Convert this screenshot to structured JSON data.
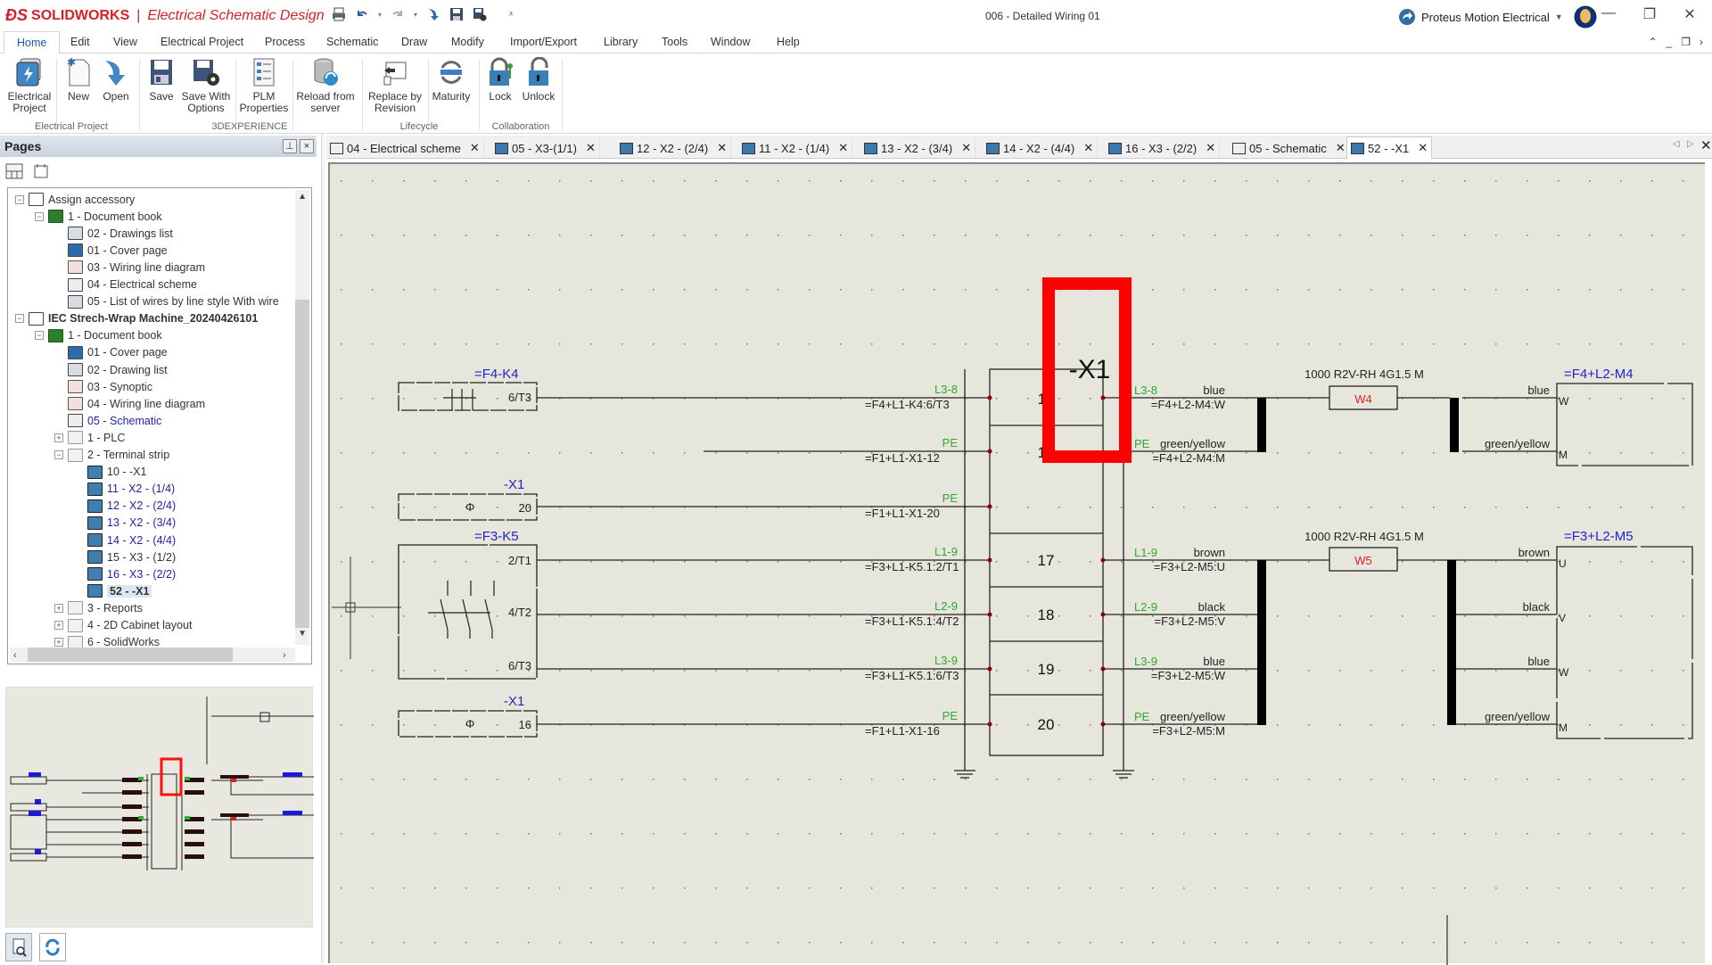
{
  "app": {
    "brand": "SOLIDWORKS",
    "product": "Electrical Schematic Design",
    "document_title": "006 - Detailed Wiring 01",
    "account": "Proteus Motion Electrical"
  },
  "window_controls": {
    "minimize": "—",
    "restore": "❐",
    "close": "✕"
  },
  "menu": {
    "items": [
      "Home",
      "Edit",
      "View",
      "Electrical Project",
      "Process",
      "Schematic",
      "Draw",
      "Modify",
      "Import/Export",
      "Library",
      "Tools",
      "Window",
      "Help"
    ],
    "active": "Home",
    "right_controls": [
      "⌃",
      "_",
      "❐",
      "›"
    ]
  },
  "ribbon": {
    "buttons": [
      {
        "label": "Electrical\nProject",
        "l1": "Electrical",
        "l2": "Project"
      },
      {
        "l1": "New",
        "l2": ""
      },
      {
        "l1": "Open",
        "l2": ""
      },
      {
        "l1": "Save",
        "l2": ""
      },
      {
        "l1": "Save With",
        "l2": "Options"
      },
      {
        "l1": "PLM",
        "l2": "Properties"
      },
      {
        "l1": "Reload from",
        "l2": "server"
      },
      {
        "l1": "Replace by",
        "l2": "Revision"
      },
      {
        "l1": "Maturity",
        "l2": ""
      },
      {
        "l1": "Lock",
        "l2": ""
      },
      {
        "l1": "Unlock",
        "l2": ""
      }
    ],
    "groups": [
      "Electrical Project",
      "3DEXPERIENCE",
      "Lifecycle",
      "Collaboration"
    ]
  },
  "pages_panel": {
    "title": "Pages",
    "pin": "⊥",
    "close": "×",
    "tree": [
      {
        "level": 0,
        "exp": "−",
        "icon": "proj",
        "label": "Assign accessory"
      },
      {
        "level": 1,
        "exp": "−",
        "icon": "book",
        "label": "1 - Document book"
      },
      {
        "level": 2,
        "icon": "list",
        "label": "02 - Drawings list"
      },
      {
        "level": 2,
        "icon": "cover",
        "label": "01 - Cover page"
      },
      {
        "level": 2,
        "icon": "wiring",
        "label": "03 - Wiring line diagram"
      },
      {
        "level": 2,
        "icon": "scheme",
        "label": "04 - Electrical scheme"
      },
      {
        "level": 2,
        "icon": "list",
        "label": "05 - List of wires by line style With wire"
      },
      {
        "level": 0,
        "exp": "−",
        "icon": "proj",
        "label": "IEC Strech-Wrap Machine_20240426101",
        "bold": true
      },
      {
        "level": 1,
        "exp": "−",
        "icon": "book",
        "label": "1 - Document book"
      },
      {
        "level": 2,
        "icon": "cover",
        "label": "01 - Cover page"
      },
      {
        "level": 2,
        "icon": "list",
        "label": "02 - Drawing list"
      },
      {
        "level": 2,
        "icon": "wiring",
        "label": "03 - Synoptic"
      },
      {
        "level": 2,
        "icon": "wiring",
        "label": "04 - Wiring line diagram"
      },
      {
        "level": 2,
        "icon": "scheme",
        "label": "05 - Schematic",
        "blue": true
      },
      {
        "level": 2,
        "exp": "+",
        "icon": "folder",
        "label": "1 - PLC"
      },
      {
        "level": 2,
        "exp": "−",
        "icon": "folder",
        "label": "2 - Terminal strip"
      },
      {
        "level": 3,
        "icon": "strip",
        "label": "10 - -X1"
      },
      {
        "level": 3,
        "icon": "strip",
        "label": "11 - X2 - (1/4)",
        "blue": true
      },
      {
        "level": 3,
        "icon": "strip",
        "label": "12 - X2 - (2/4)",
        "blue": true
      },
      {
        "level": 3,
        "icon": "strip",
        "label": "13 - X2 - (3/4)",
        "blue": true
      },
      {
        "level": 3,
        "icon": "strip",
        "label": "14 - X2 - (4/4)",
        "blue": true
      },
      {
        "level": 3,
        "icon": "strip",
        "label": "15 - X3 - (1/2)"
      },
      {
        "level": 3,
        "icon": "strip",
        "label": "16 - X3 - (2/2)",
        "blue": true
      },
      {
        "level": 3,
        "icon": "strip",
        "label": "52 - -X1",
        "bold": true,
        "selected": true
      },
      {
        "level": 2,
        "exp": "+",
        "icon": "folder",
        "label": "3 - Reports"
      },
      {
        "level": 2,
        "exp": "+",
        "icon": "folder",
        "label": "4 - 2D Cabinet layout"
      },
      {
        "level": 2,
        "exp": "+",
        "icon": "folder",
        "label": "6 - SolidWorks"
      }
    ]
  },
  "doc_tabs": [
    {
      "label": "04 - Electrical scheme",
      "icon": "scheme"
    },
    {
      "label": "05 - X3-(1/1)",
      "icon": "strip"
    },
    {
      "label": "12 - X2 - (2/4)",
      "icon": "strip"
    },
    {
      "label": "11 - X2 - (1/4)",
      "icon": "strip"
    },
    {
      "label": "13 - X2 - (3/4)",
      "icon": "strip"
    },
    {
      "label": "14 - X2 - (4/4)",
      "icon": "strip"
    },
    {
      "label": "16 - X3 - (2/2)",
      "icon": "strip"
    },
    {
      "label": "05 - Schematic",
      "icon": "scheme"
    },
    {
      "label": "52 - -X1",
      "icon": "strip",
      "active": true
    }
  ],
  "doc_tabs_close": "✕",
  "doc_tabs_nav": [
    "◁",
    "▷",
    "✕"
  ],
  "schematic": {
    "colors": {
      "wire": "#222222",
      "tag_blue": "#2323c8",
      "wire_green": "#2ea82e",
      "cable_red": "#e02020",
      "highlight": "#ff0000",
      "junction": "#8b0000"
    },
    "terminal_strip": {
      "name": "-X1",
      "terminals": [
        "15",
        "16",
        "17",
        "18",
        "19",
        "20"
      ]
    },
    "sources": [
      {
        "tag": "=F4-K4",
        "pins": [
          "6/T3"
        ]
      },
      {
        "tag": "-X1",
        "pins": [
          "20"
        ]
      },
      {
        "tag": "=F3-K5",
        "pins": [
          "2/T1",
          "4/T2",
          "6/T3"
        ]
      },
      {
        "tag": "-X1",
        "pins": [
          "16"
        ]
      }
    ],
    "left_wires": [
      {
        "wire": "L3-8",
        "ref": "=F4+L1-K4:6/T3"
      },
      {
        "wire": "PE",
        "ref": "=F1+L1-X1-12"
      },
      {
        "wire": "PE",
        "ref": "=F1+L1-X1-20"
      },
      {
        "wire": "L1-9",
        "ref": "=F3+L1-K5.1:2/T1"
      },
      {
        "wire": "L2-9",
        "ref": "=F3+L1-K5.1:4/T2"
      },
      {
        "wire": "L3-9",
        "ref": "=F3+L1-K5.1:6/T3"
      },
      {
        "wire": "PE",
        "ref": "=F1+L1-X1-16"
      }
    ],
    "right_wires": [
      {
        "wire": "L3-8",
        "color": "blue",
        "ref": "=F4+L2-M4:W"
      },
      {
        "wire": "PE",
        "color": "green/yellow",
        "ref": "=F4+L2-M4:M"
      },
      {
        "wire": "L1-9",
        "color": "brown",
        "ref": "=F3+L2-M5:U"
      },
      {
        "wire": "L2-9",
        "color": "black",
        "ref": "=F3+L2-M5:V"
      },
      {
        "wire": "L3-9",
        "color": "blue",
        "ref": "=F3+L2-M5:W"
      },
      {
        "wire": "PE",
        "color": "green/yellow",
        "ref": "=F3+L2-M5:M"
      }
    ],
    "cables": [
      {
        "name": "W4",
        "spec": "1000 R2V-RH 4G1.5 M"
      },
      {
        "name": "W5",
        "spec": "1000 R2V-RH 4G1.5 M"
      }
    ],
    "motors": [
      {
        "tag": "=F4+L2-M4",
        "pins": [
          {
            "pin": "W",
            "color": "blue"
          },
          {
            "pin": "M",
            "color": "green/yellow"
          }
        ]
      },
      {
        "tag": "=F3+L2-M5",
        "pins": [
          {
            "pin": "U",
            "color": "brown"
          },
          {
            "pin": "V",
            "color": "black"
          },
          {
            "pin": "W",
            "color": "blue"
          },
          {
            "pin": "M",
            "color": "green/yellow"
          }
        ]
      }
    ]
  }
}
